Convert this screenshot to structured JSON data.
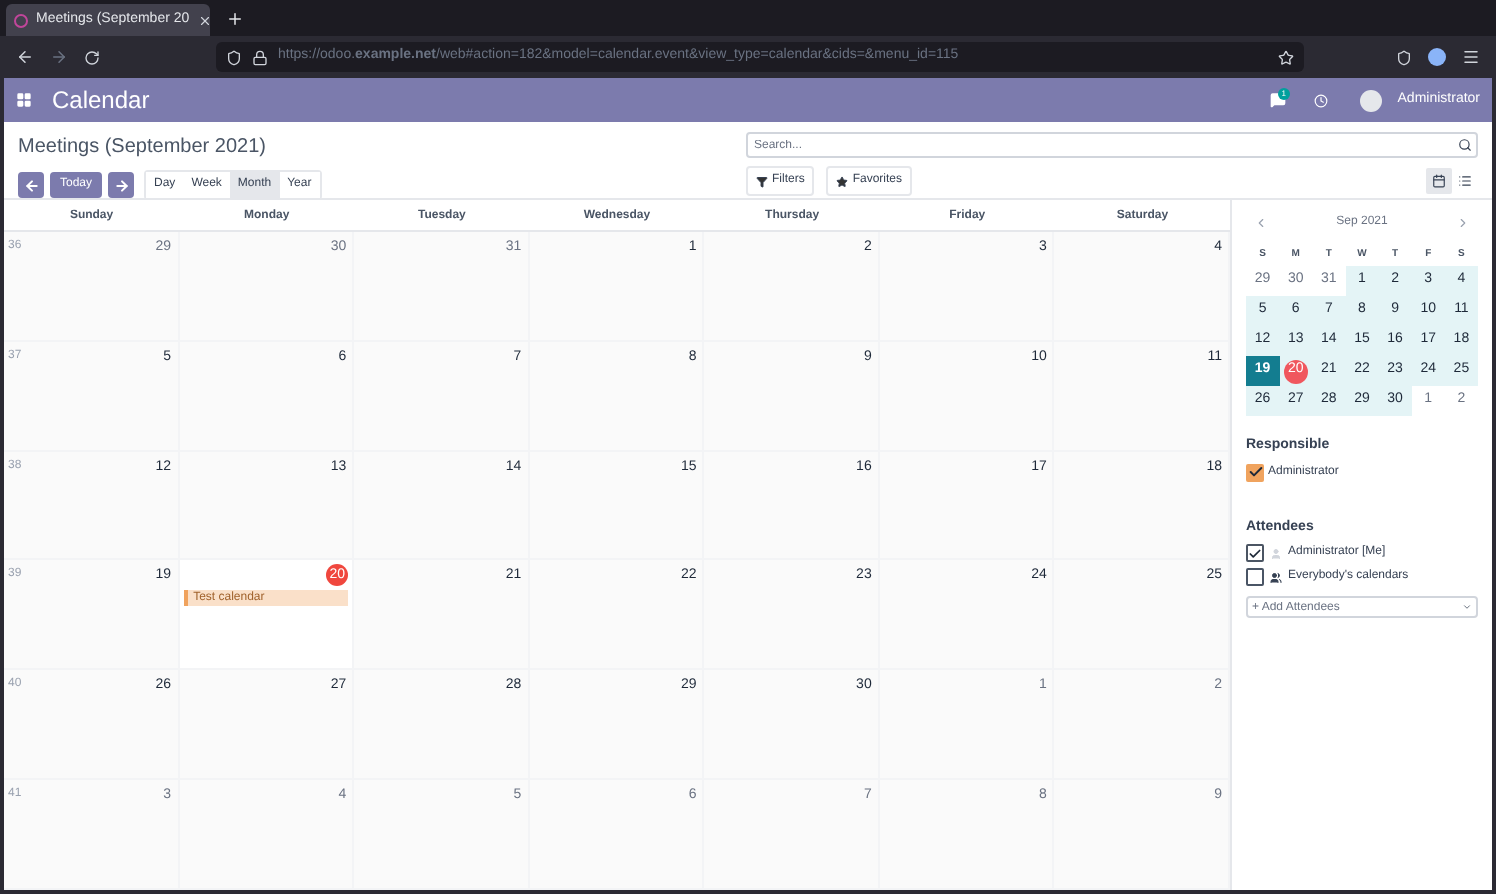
{
  "browser": {
    "tab_title": "Meetings (September 20",
    "url": "https://odoo.**example.net**/web#action=182&model=calendar.event&view_type=calendar&cids=&menu_id=115"
  },
  "navbar": {
    "app_name": "Calendar",
    "message_count": "1",
    "user_name": "Administrator"
  },
  "control_panel": {
    "title": "Meetings (September 2021)",
    "today_button": "Today",
    "scales": [
      {
        "label": "Day",
        "selected": false
      },
      {
        "label": "Week",
        "selected": false
      },
      {
        "label": "Month",
        "selected": true
      },
      {
        "label": "Year",
        "selected": false
      }
    ],
    "search": {
      "placeholder": "Search..."
    },
    "filters_button": "Filters",
    "favorites_button": "Favorites",
    "views": [
      {
        "kind": "calendar",
        "selected": true
      },
      {
        "kind": "list",
        "selected": false
      }
    ]
  },
  "calendar": {
    "weekdays": [
      "Sunday",
      "Monday",
      "Tuesday",
      "Wednesday",
      "Thursday",
      "Friday",
      "Saturday"
    ],
    "weeks": [
      {
        "number": "36",
        "days": [
          {
            "label": "29",
            "other_month": true,
            "today": false
          },
          {
            "label": "30",
            "other_month": true,
            "today": false
          },
          {
            "label": "31",
            "other_month": true,
            "today": false
          },
          {
            "label": "1",
            "other_month": false,
            "today": false
          },
          {
            "label": "2",
            "other_month": false,
            "today": false
          },
          {
            "label": "3",
            "other_month": false,
            "today": false
          },
          {
            "label": "4",
            "other_month": false,
            "today": false
          }
        ]
      },
      {
        "number": "37",
        "days": [
          {
            "label": "5",
            "other_month": false,
            "today": false
          },
          {
            "label": "6",
            "other_month": false,
            "today": false
          },
          {
            "label": "7",
            "other_month": false,
            "today": false
          },
          {
            "label": "8",
            "other_month": false,
            "today": false
          },
          {
            "label": "9",
            "other_month": false,
            "today": false
          },
          {
            "label": "10",
            "other_month": false,
            "today": false
          },
          {
            "label": "11",
            "other_month": false,
            "today": false
          }
        ]
      },
      {
        "number": "38",
        "days": [
          {
            "label": "12",
            "other_month": false,
            "today": false
          },
          {
            "label": "13",
            "other_month": false,
            "today": false
          },
          {
            "label": "14",
            "other_month": false,
            "today": false
          },
          {
            "label": "15",
            "other_month": false,
            "today": false
          },
          {
            "label": "16",
            "other_month": false,
            "today": false
          },
          {
            "label": "17",
            "other_month": false,
            "today": false
          },
          {
            "label": "18",
            "other_month": false,
            "today": false
          }
        ]
      },
      {
        "number": "39",
        "days": [
          {
            "label": "19",
            "other_month": false,
            "today": false
          },
          {
            "label": "20",
            "other_month": false,
            "today": true,
            "events": [
              {
                "title": "Test calendar",
                "color": "#f0a35e"
              }
            ]
          },
          {
            "label": "21",
            "other_month": false,
            "today": false
          },
          {
            "label": "22",
            "other_month": false,
            "today": false
          },
          {
            "label": "23",
            "other_month": false,
            "today": false
          },
          {
            "label": "24",
            "other_month": false,
            "today": false
          },
          {
            "label": "25",
            "other_month": false,
            "today": false
          }
        ]
      },
      {
        "number": "40",
        "days": [
          {
            "label": "26",
            "other_month": false,
            "today": false
          },
          {
            "label": "27",
            "other_month": false,
            "today": false
          },
          {
            "label": "28",
            "other_month": false,
            "today": false
          },
          {
            "label": "29",
            "other_month": false,
            "today": false
          },
          {
            "label": "30",
            "other_month": false,
            "today": false
          },
          {
            "label": "1",
            "other_month": true,
            "today": false
          },
          {
            "label": "2",
            "other_month": true,
            "today": false
          }
        ]
      },
      {
        "number": "41",
        "days": [
          {
            "label": "3",
            "other_month": true,
            "today": false
          },
          {
            "label": "4",
            "other_month": true,
            "today": false
          },
          {
            "label": "5",
            "other_month": true,
            "today": false
          },
          {
            "label": "6",
            "other_month": true,
            "today": false
          },
          {
            "label": "7",
            "other_month": true,
            "today": false
          },
          {
            "label": "8",
            "other_month": true,
            "today": false
          },
          {
            "label": "9",
            "other_month": true,
            "today": false
          }
        ]
      }
    ]
  },
  "sidebar": {
    "mini_calendar": {
      "month": "Sep 2021",
      "weekdays": [
        "S",
        "M",
        "T",
        "W",
        "T",
        "F",
        "S"
      ],
      "days": [
        {
          "label": "29",
          "other_month": true,
          "selected": false,
          "today": false
        },
        {
          "label": "30",
          "other_month": true,
          "selected": false,
          "today": false
        },
        {
          "label": "31",
          "other_month": true,
          "selected": false,
          "today": false
        },
        {
          "label": "1",
          "other_month": false,
          "selected": false,
          "today": false
        },
        {
          "label": "2",
          "other_month": false,
          "selected": false,
          "today": false
        },
        {
          "label": "3",
          "other_month": false,
          "selected": false,
          "today": false
        },
        {
          "label": "4",
          "other_month": false,
          "selected": false,
          "today": false
        },
        {
          "label": "5",
          "other_month": false,
          "selected": false,
          "today": false
        },
        {
          "label": "6",
          "other_month": false,
          "selected": false,
          "today": false
        },
        {
          "label": "7",
          "other_month": false,
          "selected": false,
          "today": false
        },
        {
          "label": "8",
          "other_month": false,
          "selected": false,
          "today": false
        },
        {
          "label": "9",
          "other_month": false,
          "selected": false,
          "today": false
        },
        {
          "label": "10",
          "other_month": false,
          "selected": false,
          "today": false
        },
        {
          "label": "11",
          "other_month": false,
          "selected": false,
          "today": false
        },
        {
          "label": "12",
          "other_month": false,
          "selected": false,
          "today": false
        },
        {
          "label": "13",
          "other_month": false,
          "selected": false,
          "today": false
        },
        {
          "label": "14",
          "other_month": false,
          "selected": false,
          "today": false
        },
        {
          "label": "15",
          "other_month": false,
          "selected": false,
          "today": false
        },
        {
          "label": "16",
          "other_month": false,
          "selected": false,
          "today": false
        },
        {
          "label": "17",
          "other_month": false,
          "selected": false,
          "today": false
        },
        {
          "label": "18",
          "other_month": false,
          "selected": false,
          "today": false
        },
        {
          "label": "19",
          "other_month": false,
          "selected": true,
          "today": false
        },
        {
          "label": "20",
          "other_month": false,
          "selected": false,
          "today": true
        },
        {
          "label": "21",
          "other_month": false,
          "selected": false,
          "today": false
        },
        {
          "label": "22",
          "other_month": false,
          "selected": false,
          "today": false
        },
        {
          "label": "23",
          "other_month": false,
          "selected": false,
          "today": false
        },
        {
          "label": "24",
          "other_month": false,
          "selected": false,
          "today": false
        },
        {
          "label": "25",
          "other_month": false,
          "selected": false,
          "today": false
        },
        {
          "label": "26",
          "other_month": false,
          "selected": false,
          "today": false
        },
        {
          "label": "27",
          "other_month": false,
          "selected": false,
          "today": false
        },
        {
          "label": "28",
          "other_month": false,
          "selected": false,
          "today": false
        },
        {
          "label": "29",
          "other_month": false,
          "selected": false,
          "today": false
        },
        {
          "label": "30",
          "other_month": false,
          "selected": false,
          "today": false
        },
        {
          "label": "1",
          "other_month": true,
          "selected": false,
          "today": false
        },
        {
          "label": "2",
          "other_month": true,
          "selected": false,
          "today": false
        }
      ]
    },
    "responsible": {
      "title": "Responsible",
      "items": [
        {
          "label": "Administrator",
          "checked": true,
          "color": "#f0a35e"
        }
      ]
    },
    "attendees": {
      "title": "Attendees",
      "items": [
        {
          "label": "Administrator [Me]",
          "checked": true,
          "kind": "user"
        },
        {
          "label": "Everybody's calendars",
          "checked": false,
          "kind": "group"
        }
      ],
      "add_placeholder": "+ Add Attendees"
    }
  }
}
